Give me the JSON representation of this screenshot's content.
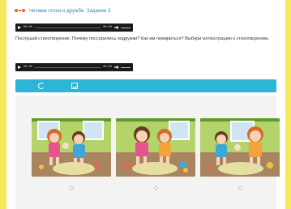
{
  "header": {
    "title": "Читаем стихи о дружбе. Задание 3"
  },
  "audio_players": [
    {
      "time_start": "00:00",
      "time_end": "00:00"
    },
    {
      "time_start": "00:00",
      "time_end": "00:00"
    }
  ],
  "task": {
    "text": "Послушай стихотворение. Почему поссорились подружки? Как им помириться? Выбери иллюстрацию к стихотворению."
  },
  "toolbar": {
    "icons": [
      "refresh-icon",
      "check-icon"
    ]
  },
  "options": [
    {
      "icon": "illustration-girls-fighting"
    },
    {
      "icon": "illustration-girls-arguing"
    },
    {
      "icon": "illustration-girls-sharing"
    }
  ],
  "colors": {
    "background": "#f4ea5c",
    "accent": "#2bb5d6",
    "title": "#1f8db5",
    "header_icon": "#e8622c"
  }
}
